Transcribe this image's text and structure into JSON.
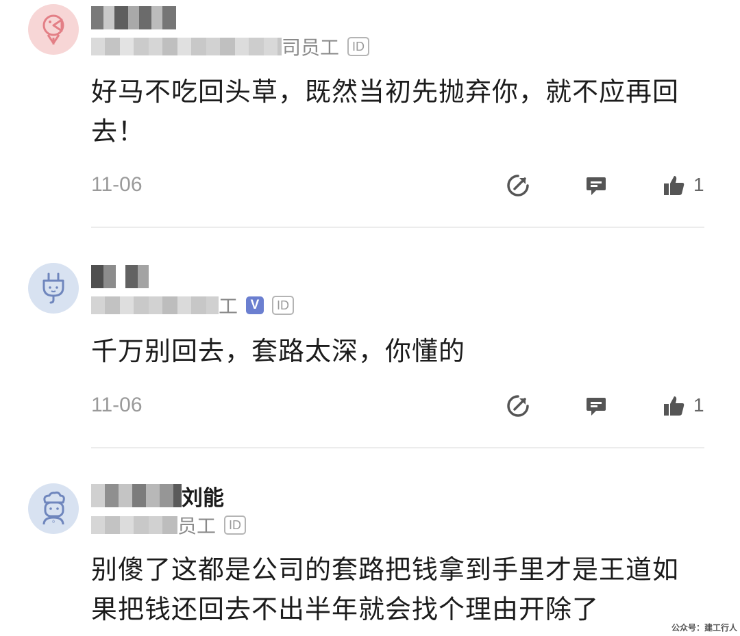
{
  "comments": [
    {
      "name_visible": "",
      "meta_visible": "司员工",
      "id_badge": "ID",
      "verified_badge": "",
      "text": "好马不吃回头草，既然当初先抛弃你，就不应再回去！",
      "date": "11-06",
      "likes": "1",
      "avatar_color": "#f7d6d6",
      "avatar_icon": "chick-icon"
    },
    {
      "name_visible": "",
      "meta_visible": "工",
      "id_badge": "ID",
      "verified_badge": "V",
      "text": "千万别回去，套路太深，你懂的",
      "date": "11-06",
      "likes": "1",
      "avatar_color": "#d8e2f1",
      "avatar_icon": "plug-icon"
    },
    {
      "name_visible": "刘能",
      "meta_visible": "员工",
      "id_badge": "ID",
      "verified_badge": "",
      "text": "别傻了这都是公司的套路把钱拿到手里才是王道如果把钱还回去不出半年就会找个理由开除了",
      "avatar_color": "#d8e2f1",
      "avatar_icon": "chef-icon"
    }
  ],
  "watermark": "公众号：建工行人",
  "colors": {
    "text": "#1c1c1c",
    "muted": "#9a9a9a",
    "icon": "#555555",
    "verified": "#6b7fd0",
    "divider": "#ececec"
  }
}
